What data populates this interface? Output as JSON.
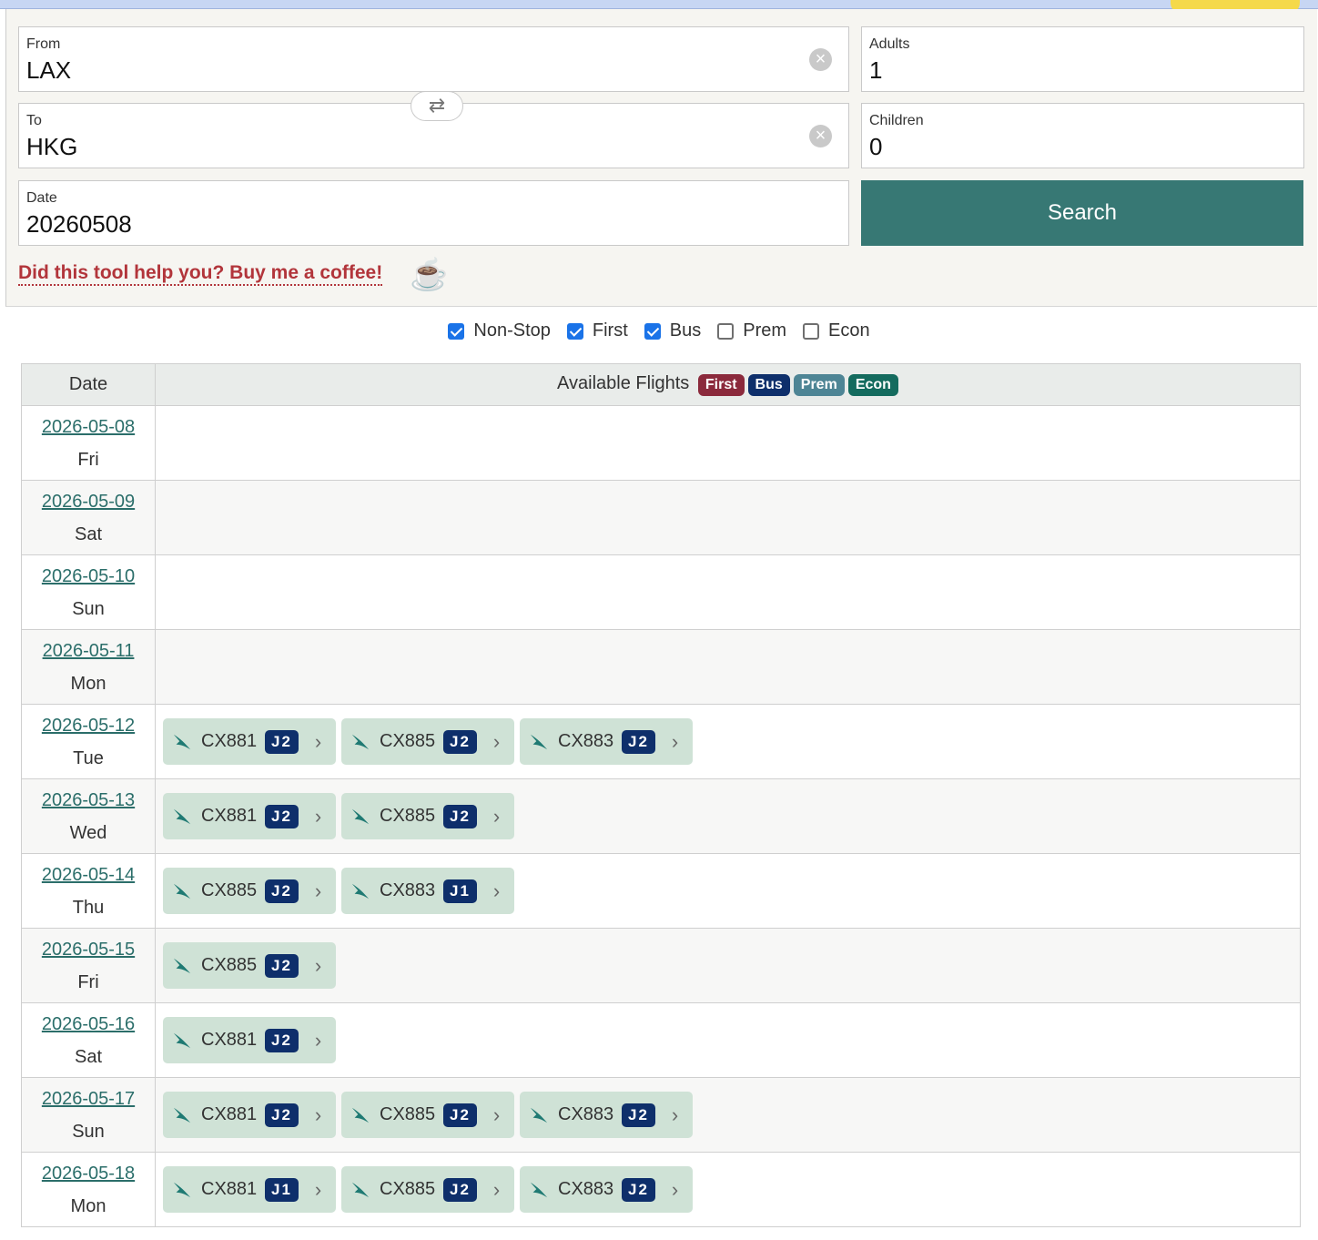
{
  "form": {
    "from_label": "From",
    "from_value": "LAX",
    "to_label": "To",
    "to_value": "HKG",
    "date_label": "Date",
    "date_value": "20260508",
    "adults_label": "Adults",
    "adults_value": "1",
    "children_label": "Children",
    "children_value": "0",
    "search_label": "Search",
    "coffee_text": "Did this tool help you? Buy me a coffee!",
    "coffee_icon": "☕"
  },
  "filters": [
    {
      "label": "Non-Stop",
      "checked": true
    },
    {
      "label": "First",
      "checked": true
    },
    {
      "label": "Bus",
      "checked": true
    },
    {
      "label": "Prem",
      "checked": false
    },
    {
      "label": "Econ",
      "checked": false
    }
  ],
  "table": {
    "date_header": "Date",
    "flights_header": "Available Flights",
    "legend": [
      {
        "label": "First",
        "color": "#8b2a3c"
      },
      {
        "label": "Bus",
        "color": "#0e2f6b"
      },
      {
        "label": "Prem",
        "color": "#4e8595"
      },
      {
        "label": "Econ",
        "color": "#146b5e"
      }
    ],
    "rows": [
      {
        "date": "2026-05-08",
        "day": "Fri",
        "flights": []
      },
      {
        "date": "2026-05-09",
        "day": "Sat",
        "flights": []
      },
      {
        "date": "2026-05-10",
        "day": "Sun",
        "flights": []
      },
      {
        "date": "2026-05-11",
        "day": "Mon",
        "flights": []
      },
      {
        "date": "2026-05-12",
        "day": "Tue",
        "flights": [
          {
            "no": "CX881",
            "cls": "J2"
          },
          {
            "no": "CX885",
            "cls": "J2"
          },
          {
            "no": "CX883",
            "cls": "J2"
          }
        ]
      },
      {
        "date": "2026-05-13",
        "day": "Wed",
        "flights": [
          {
            "no": "CX881",
            "cls": "J2"
          },
          {
            "no": "CX885",
            "cls": "J2"
          }
        ]
      },
      {
        "date": "2026-05-14",
        "day": "Thu",
        "flights": [
          {
            "no": "CX885",
            "cls": "J2"
          },
          {
            "no": "CX883",
            "cls": "J1"
          }
        ]
      },
      {
        "date": "2026-05-15",
        "day": "Fri",
        "flights": [
          {
            "no": "CX885",
            "cls": "J2"
          }
        ]
      },
      {
        "date": "2026-05-16",
        "day": "Sat",
        "flights": [
          {
            "no": "CX881",
            "cls": "J2"
          }
        ]
      },
      {
        "date": "2026-05-17",
        "day": "Sun",
        "flights": [
          {
            "no": "CX881",
            "cls": "J2"
          },
          {
            "no": "CX885",
            "cls": "J2"
          },
          {
            "no": "CX883",
            "cls": "J2"
          }
        ]
      },
      {
        "date": "2026-05-18",
        "day": "Mon",
        "flights": [
          {
            "no": "CX881",
            "cls": "J1"
          },
          {
            "no": "CX885",
            "cls": "J2"
          },
          {
            "no": "CX883",
            "cls": "J2"
          }
        ]
      }
    ]
  }
}
